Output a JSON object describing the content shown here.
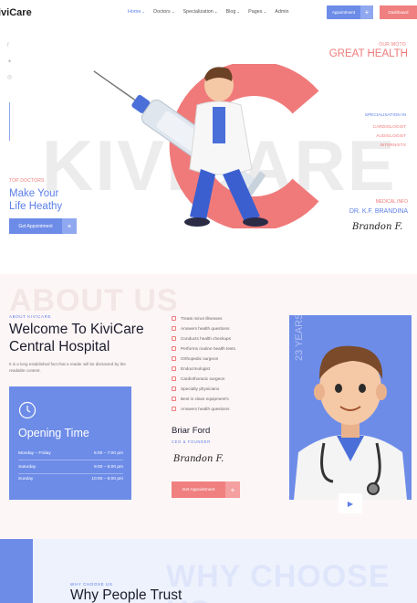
{
  "header": {
    "logo_prefix": "iviCare",
    "nav": [
      {
        "label": "Home",
        "active": true
      },
      {
        "label": "Doctors",
        "active": false
      },
      {
        "label": "Specialization",
        "active": false
      },
      {
        "label": "Blog",
        "active": false
      },
      {
        "label": "Pages",
        "active": false
      },
      {
        "label": "Admin",
        "active": false
      }
    ],
    "appointment_label": "Appointment",
    "dashboard_label": "Dashboard"
  },
  "hero": {
    "watermark": "KIVICARE",
    "moto_label": "OUR MOTO",
    "moto_title": "GREAT HEALTH",
    "specialisation_label": "SPECIALISATION IN",
    "specialisations": [
      "CARDIOLOGIST",
      "AUDIOLOGIST",
      "INTERNISTS"
    ],
    "top_doctors_label": "TOP DOCTORS",
    "title_line1": "Make Your",
    "title_line2": "Life Heathy",
    "button_label": "Get Appointment",
    "medical_info_label": "MEDICAL INFO",
    "doctor_name": "DR. K.F. BRANDINA",
    "signature": "Brandon F."
  },
  "about": {
    "watermark": "ABOUT US",
    "label": "ABOUT KIVICARE",
    "title_line1": "Welcome To KiviCare",
    "title_line2": "Central Hospital",
    "description": "It is a long established fact that a reader will be distracted by the readable content.",
    "hours": {
      "title": "Opening Time",
      "rows": [
        {
          "day": "Monday – Friday",
          "time": "6:00 – 7:00 pm"
        },
        {
          "day": "Saturday",
          "time": "9:00 – 8:00 pm"
        },
        {
          "day": "Sunday",
          "time": "10:00 – 9:00 pm"
        }
      ]
    },
    "services": [
      "Treats minor illnesses",
      "Answers health questions",
      "Conducts health checkups",
      "Performs routine health tests",
      "Orthopedic surgeon",
      "Endocrinologist",
      "Cardiothoracic surgeon",
      "Specialty physicians",
      "Best in class equipment's",
      "Answers health questions"
    ],
    "doctor_name": "Briar Ford",
    "doctor_role": "CEO & FOUNDER",
    "signature": "Brandon F.",
    "button_label": "Get Appointment",
    "years": "23 YEARS"
  },
  "why": {
    "watermark": "WHY CHOOSE US",
    "label": "WHY CHOOSE US",
    "title": "Why People Trust"
  },
  "colors": {
    "primary": "#6d8ce8",
    "accent": "#f08080",
    "text": "#1c1c2e"
  }
}
